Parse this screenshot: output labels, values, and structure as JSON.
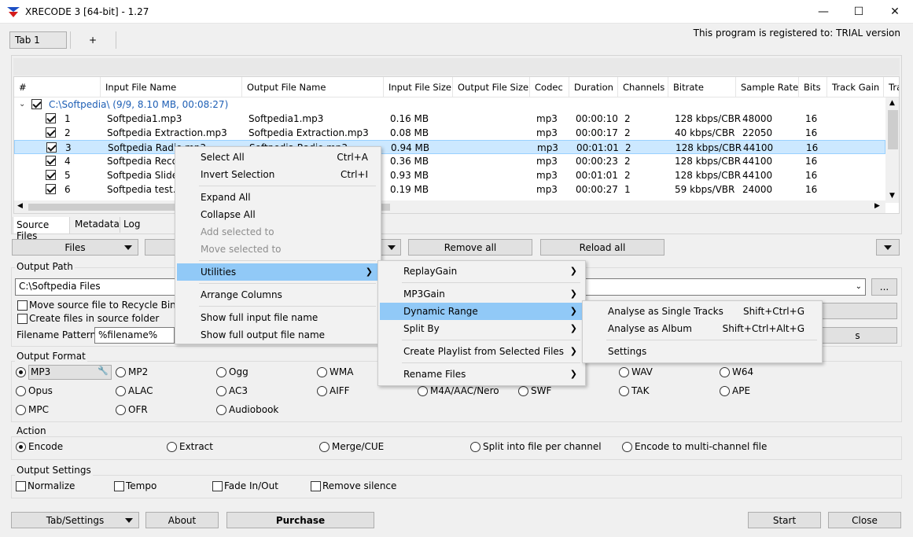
{
  "window": {
    "title": "XRECODE 3 [64-bit] - 1.27"
  },
  "tabs": [
    {
      "label": "Tab 1"
    },
    {
      "label": "+"
    }
  ],
  "registration": "This program is registered to: TRIAL version",
  "columns": [
    "#",
    "Input File Name",
    "Output File Name",
    "Input File Size",
    "Output File Size",
    "Codec",
    "Duration",
    "Channels",
    "Bitrate",
    "Sample Rate",
    "Bits",
    "Track Gain",
    "Tra"
  ],
  "group": {
    "label": "C:\\Softpedia\\ (9/9, 8.10 MB, 00:08:27)"
  },
  "rows": [
    {
      "num": "1",
      "input": "Softpedia1.mp3",
      "output": "Softpedia1.mp3",
      "insize": "0.16 MB",
      "codec": "mp3",
      "duration": "00:00:10",
      "channels": "2",
      "bitrate": "128 kbps/CBR",
      "rate": "48000",
      "bits": "16"
    },
    {
      "num": "2",
      "input": "Softpedia Extraction.mp3",
      "output": "Softpedia Extraction.mp3",
      "insize": "0.08 MB",
      "codec": "mp3",
      "duration": "00:00:17",
      "channels": "2",
      "bitrate": "40 kbps/CBR",
      "rate": "22050",
      "bits": "16"
    },
    {
      "num": "3",
      "input": "Softpedia Radio.mp3",
      "output": "Softpedia Radio.mp3",
      "insize": "0.94 MB",
      "codec": "mp3",
      "duration": "00:01:01",
      "channels": "2",
      "bitrate": "128 kbps/CBR",
      "rate": "44100",
      "bits": "16"
    },
    {
      "num": "4",
      "input": "Softpedia Recor",
      "output": "",
      "insize": "0.36 MB",
      "codec": "mp3",
      "duration": "00:00:23",
      "channels": "2",
      "bitrate": "128 kbps/CBR",
      "rate": "44100",
      "bits": "16"
    },
    {
      "num": "5",
      "input": "Softpedia Slides",
      "output": "",
      "insize": "0.93 MB",
      "codec": "mp3",
      "duration": "00:01:01",
      "channels": "2",
      "bitrate": "128 kbps/CBR",
      "rate": "44100",
      "bits": "16"
    },
    {
      "num": "6",
      "input": "Softpedia test.m",
      "output": "",
      "insize": "0.19 MB",
      "codec": "mp3",
      "duration": "00:00:27",
      "channels": "1",
      "bitrate": "59 kbps/VBR",
      "rate": "24000",
      "bits": "16"
    }
  ],
  "bottom_tabs": [
    "Source Files",
    "Metadata",
    "Log"
  ],
  "buttons": {
    "files": "Files",
    "remove_all": "Remove all",
    "reload_all": "Reload all",
    "browse": "...",
    "tab_settings": "Tab/Settings",
    "about": "About",
    "purchase": "Purchase",
    "start": "Start",
    "close": "Close"
  },
  "output_path": {
    "label": "Output Path",
    "value": "C:\\Softpedia Files",
    "move_recycle": "Move source file to Recycle Bin wh",
    "create_in_source": "Create files in source folder",
    "pattern_label": "Filename Pattern:",
    "pattern_value": "%filename%"
  },
  "output_format": {
    "label": "Output Format",
    "options": [
      "MP3",
      "MP2",
      "Ogg",
      "WMA",
      "WAV",
      "W64",
      "Opus",
      "ALAC",
      "AC3",
      "AIFF",
      "M4A/AAC/Nero",
      "SWF",
      "TAK",
      "APE",
      "MPC",
      "OFR",
      "Audiobook"
    ],
    "selected": "MP3"
  },
  "action": {
    "label": "Action",
    "options": [
      "Encode",
      "Extract",
      "Merge/CUE",
      "Split into file per channel",
      "Encode to multi-channel file"
    ],
    "selected": "Encode"
  },
  "output_settings": {
    "label": "Output Settings",
    "options": [
      "Normalize",
      "Tempo",
      "Fade In/Out",
      "Remove silence"
    ]
  },
  "context_menu": {
    "items": [
      {
        "label": "Select All",
        "shortcut": "Ctrl+A"
      },
      {
        "label": "Invert Selection",
        "shortcut": "Ctrl+I"
      },
      {
        "label": "Expand All"
      },
      {
        "label": "Collapse All"
      },
      {
        "label": "Add selected to"
      },
      {
        "label": "Move selected to"
      },
      {
        "label": "Utilities"
      },
      {
        "label": "Arrange Columns"
      },
      {
        "label": "Show full input file name"
      },
      {
        "label": "Show full output file name"
      }
    ]
  },
  "utilities_menu": {
    "items": [
      {
        "label": "ReplayGain"
      },
      {
        "label": "MP3Gain"
      },
      {
        "label": "Dynamic Range"
      },
      {
        "label": "Split By"
      },
      {
        "label": "Create Playlist from Selected Files"
      },
      {
        "label": "Rename Files"
      }
    ]
  },
  "dynamic_range_menu": {
    "items": [
      {
        "label": "Analyse as Single Tracks",
        "shortcut": "Shift+Ctrl+G"
      },
      {
        "label": "Analyse as Album",
        "shortcut": "Shift+Ctrl+Alt+G"
      },
      {
        "label": "Settings"
      }
    ]
  }
}
